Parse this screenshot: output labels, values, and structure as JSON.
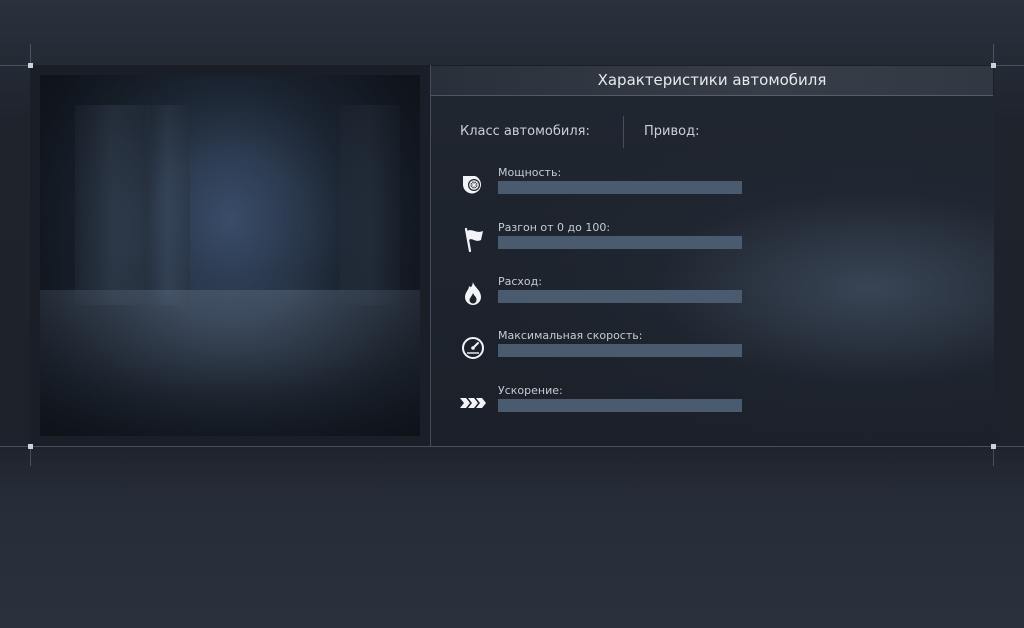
{
  "window": {
    "title": "Характеристики автомобиля"
  },
  "info": {
    "class_label": "Класс автомобиля:",
    "class_value": "",
    "drive_label": "Привод:",
    "drive_value": ""
  },
  "stats": [
    {
      "label": "Мощность:",
      "icon": "turbo-icon",
      "level": 0
    },
    {
      "label": "Разгон от 0 до 100:",
      "icon": "flag-icon",
      "level": 0
    },
    {
      "label": "Расход:",
      "icon": "fuel-flame-icon",
      "level": 0
    },
    {
      "label": "Максимальная скорость:",
      "icon": "speedometer-icon",
      "level": 0
    },
    {
      "label": "Ускорение:",
      "icon": "chevrons-right-icon",
      "level": 0
    }
  ],
  "colors": {
    "background": "#2a303b",
    "panel": "#1a1f27",
    "bar_track": "#4a5b70",
    "bar_fill": "#7a93b0",
    "text": "#e6eaef",
    "frame_line": "#8ca0b9"
  }
}
